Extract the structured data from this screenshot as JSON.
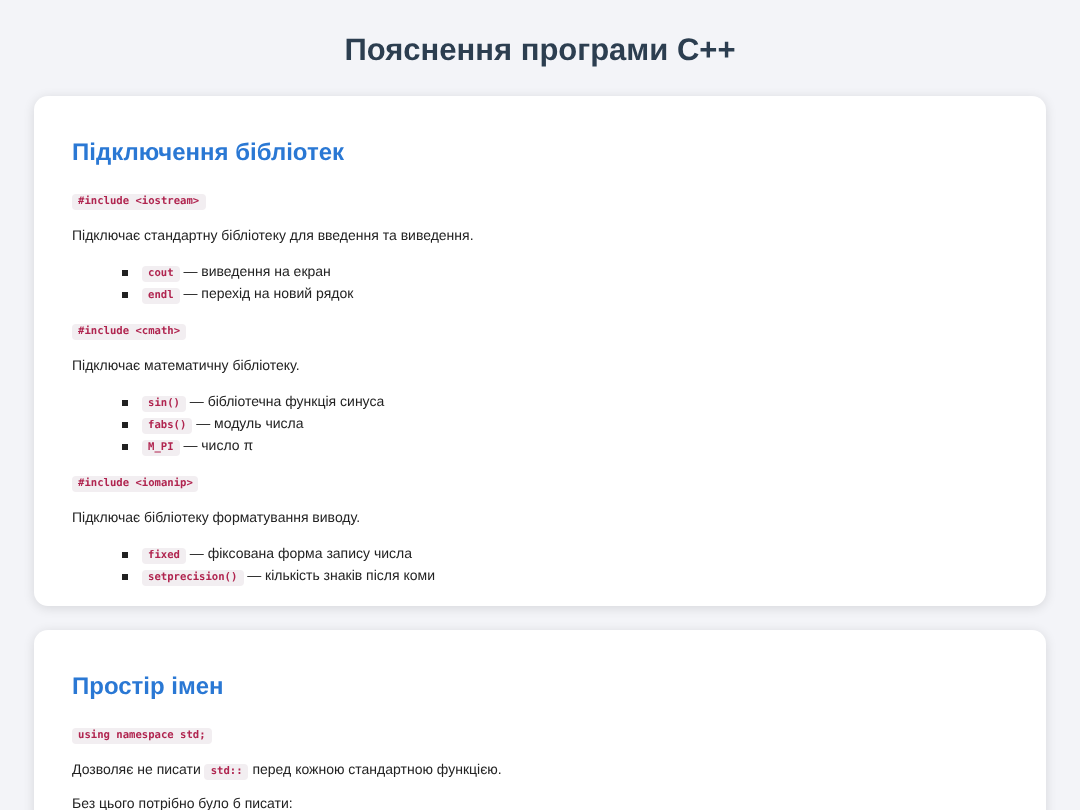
{
  "title": "Пояснення програми C++",
  "sections": [
    {
      "heading": "Підключення бібліотек",
      "blocks": [
        {
          "kind": "code",
          "code": "#include <iostream>"
        },
        {
          "kind": "text",
          "parts": [
            {
              "text": "Підключає стандартну бібліотеку для введення та виведення."
            }
          ]
        },
        {
          "kind": "list",
          "items": [
            {
              "code": "cout",
              "text": "— виведення на екран"
            },
            {
              "code": "endl",
              "text": "— перехід на новий рядок"
            }
          ]
        },
        {
          "kind": "code",
          "code": "#include <cmath>"
        },
        {
          "kind": "text",
          "parts": [
            {
              "text": "Підключає математичну бібліотеку."
            }
          ]
        },
        {
          "kind": "list",
          "items": [
            {
              "code": "sin()",
              "text": "— бібліотечна функція синуса"
            },
            {
              "code": "fabs()",
              "text": "— модуль числа"
            },
            {
              "code": "M_PI",
              "text": "— число π"
            }
          ]
        },
        {
          "kind": "code",
          "code": "#include <iomanip>"
        },
        {
          "kind": "text",
          "parts": [
            {
              "text": "Підключає бібліотеку форматування виводу."
            }
          ]
        },
        {
          "kind": "list",
          "items": [
            {
              "code": "fixed",
              "text": "— фіксована форма запису числа"
            },
            {
              "code": "setprecision()",
              "text": "— кількість знаків після коми"
            }
          ]
        }
      ]
    },
    {
      "heading": "Простір імен",
      "blocks": [
        {
          "kind": "code",
          "code": "using namespace std;"
        },
        {
          "kind": "text",
          "parts": [
            {
              "text": "Дозволяє не писати "
            },
            {
              "code": "std::"
            },
            {
              "text": " перед кожною стандартною функцією."
            }
          ]
        },
        {
          "kind": "text",
          "parts": [
            {
              "text": "Без цього потрібно було б писати:"
            }
          ]
        }
      ]
    }
  ]
}
